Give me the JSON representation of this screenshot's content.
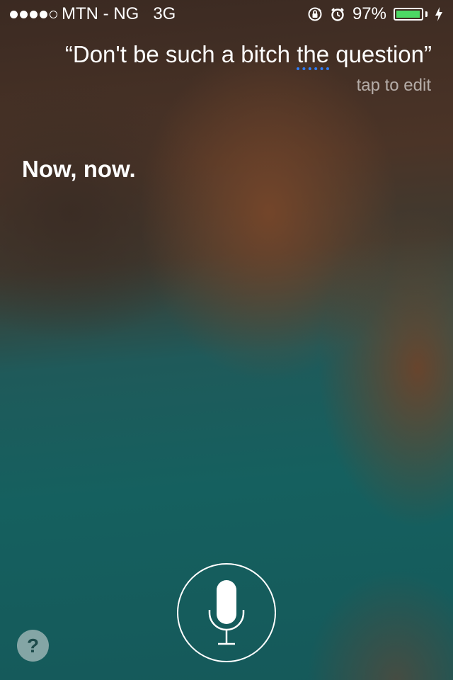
{
  "status_bar": {
    "signal_dots_filled": 4,
    "signal_dots_total": 5,
    "carrier": "MTN - NG",
    "network": "3G",
    "battery_percent_label": "97%",
    "battery_level": 0.97,
    "icons": [
      "orientation-lock-icon",
      "alarm-icon",
      "battery-icon",
      "charging-bolt-icon"
    ],
    "battery_color": "#4cd964"
  },
  "siri": {
    "query_open_quote": "“",
    "query_before": "Don't be such a bitch ",
    "query_underlined": "the",
    "query_after": " question",
    "query_close_quote": "”",
    "tap_to_edit": "tap to edit",
    "reply": "Now, now.",
    "underline_color": "#2f7fff"
  },
  "controls": {
    "mic_icon": "microphone-icon",
    "help_label": "?"
  }
}
